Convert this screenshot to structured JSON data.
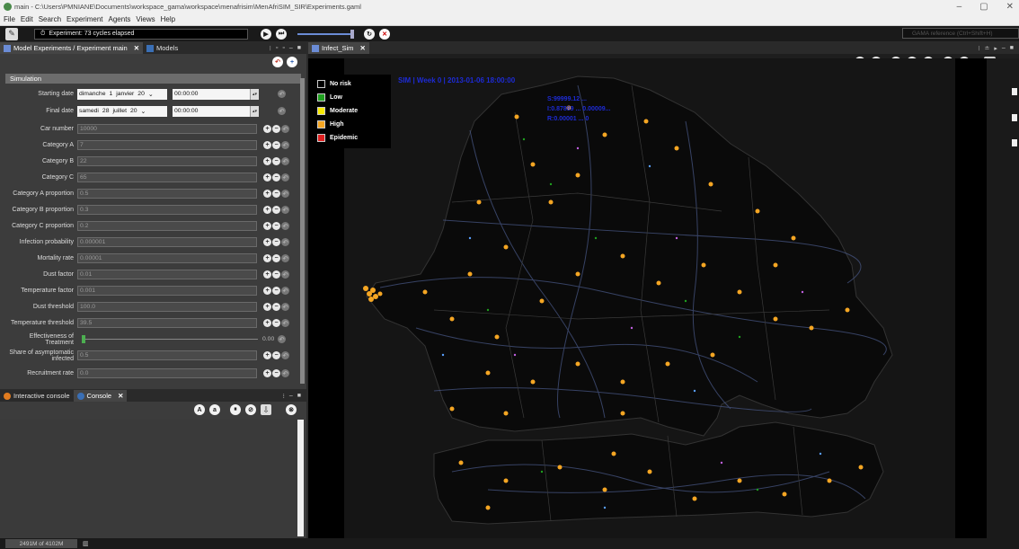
{
  "window": {
    "title": "main - C:\\Users\\PMNIANE\\Documents\\workspace_gama\\workspace\\menafrisim\\MenAfriSIM_SIR\\Experiments.gaml",
    "controls": [
      "–",
      "▢",
      "✕"
    ]
  },
  "menu": [
    "File",
    "Edit",
    "Search",
    "Experiment",
    "Agents",
    "Views",
    "Help"
  ],
  "toolbar": {
    "experiment_status": "Experiment: 73 cycles elapsed",
    "search_placeholder": "GAMA reference (Ctrl+Shift+H)"
  },
  "left_panel": {
    "tabs": [
      {
        "label": "Model Experiments / Experiment main",
        "active": true
      },
      {
        "label": "Models",
        "active": false
      }
    ],
    "section": "Simulation",
    "params": {
      "starting_date": {
        "label": "Starting date",
        "day_name": "dimanche",
        "day": "1",
        "month": "janvier",
        "year": "20",
        "time": "00:00:00"
      },
      "final_date": {
        "label": "Final date",
        "day_name": "samedi",
        "day": "28",
        "month": "juillet",
        "year": "20",
        "time": "00:00:00"
      },
      "car_number": {
        "label": "Car number",
        "value": "10000"
      },
      "category_a": {
        "label": "Category A",
        "value": "7"
      },
      "category_b": {
        "label": "Category B",
        "value": "22"
      },
      "category_c": {
        "label": "Category C",
        "value": "65"
      },
      "cat_a_prop": {
        "label": "Category A proportion",
        "value": "0.5"
      },
      "cat_b_prop": {
        "label": "Category B proportion",
        "value": "0.3"
      },
      "cat_c_prop": {
        "label": "Category C proportion",
        "value": "0.2"
      },
      "infection_prob": {
        "label": "Infection probability",
        "value": "0.000001"
      },
      "mortality": {
        "label": "Mortality rate",
        "value": "0.00001"
      },
      "dust_factor": {
        "label": "Dust factor",
        "value": "0.01"
      },
      "temp_factor": {
        "label": "Temperature factor",
        "value": "0.001"
      },
      "dust_threshold": {
        "label": "Dust threshold",
        "value": "100.0"
      },
      "temp_threshold": {
        "label": "Temperature threshold",
        "value": "39.5"
      },
      "treatment": {
        "label": "Effectiveness of Treatment",
        "value": "0.00",
        "level": 0
      },
      "asymptomatic": {
        "label": "Share of asymptomatic infected",
        "value": "0.5"
      },
      "recruitment": {
        "label": "Recruitment rate",
        "value": "0.0"
      }
    }
  },
  "console_panel": {
    "tabs": [
      {
        "label": "Interactive console",
        "active": false
      },
      {
        "label": "Console",
        "active": true
      }
    ]
  },
  "sim_view": {
    "tab": "Infect_Sim",
    "header": "SIM | Week 0 | 2013-01-06 18:00:00",
    "stats": [
      "S:99999.12 ...",
      "I:0.87889 ... 0.00009...",
      "R:0.00001 ... 0"
    ],
    "legend": [
      {
        "label": "No risk",
        "color": "#000000"
      },
      {
        "label": "Low",
        "color": "#1fa01f"
      },
      {
        "label": "Moderate",
        "color": "#f5e800"
      },
      {
        "label": "High",
        "color": "#f5a623"
      },
      {
        "label": "Epidemic",
        "color": "#e02020"
      }
    ]
  },
  "status": {
    "memory": "2491M of 4102M"
  }
}
